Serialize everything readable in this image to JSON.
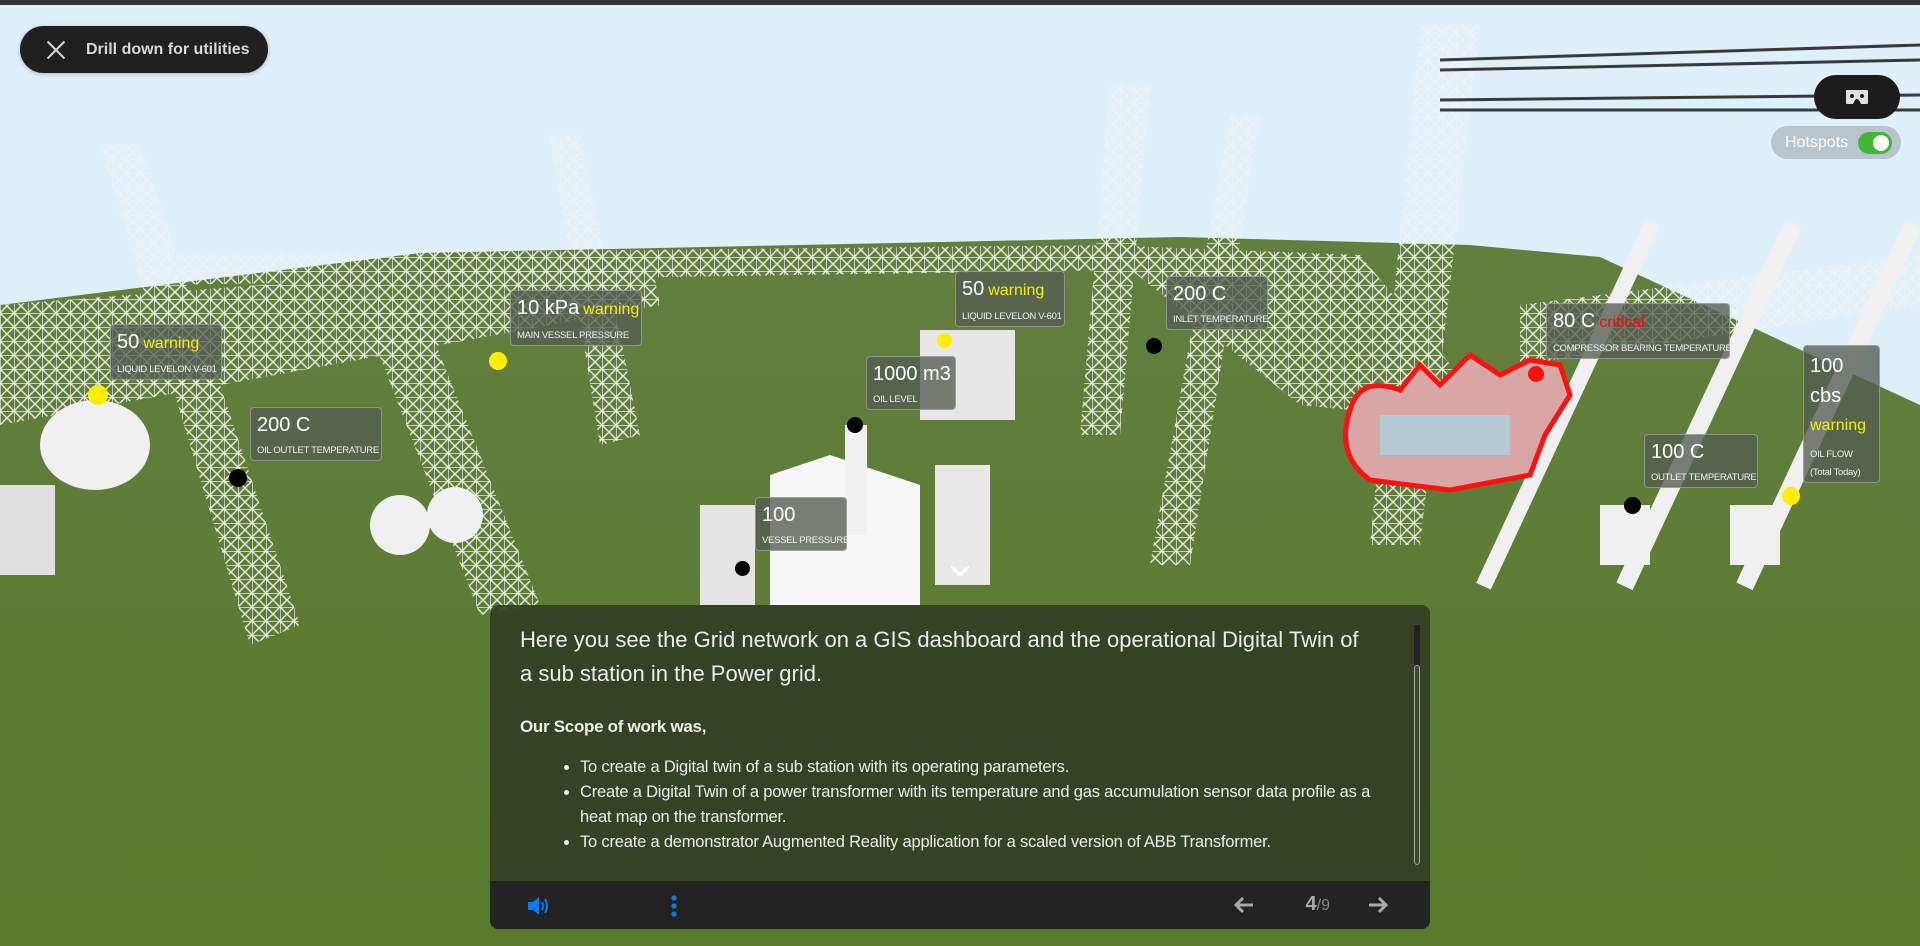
{
  "top_controls": {
    "drill_button_label": "Drill down for utilities",
    "drill_icon": "close-x-icon",
    "vr_icon": "vr-headset-icon",
    "hotspots_label": "Hotspots",
    "hotspots_enabled": true
  },
  "hotspots": [
    {
      "value": "50",
      "status": "warning",
      "name": "LIQUID LEVELON V-601",
      "dot": "yellow"
    },
    {
      "value": "10 kPa",
      "status": "warning",
      "name": "MAIN VESSEL PRESSURE",
      "dot": "yellow"
    },
    {
      "value": "200 C",
      "status": "",
      "name": "OIL OUTLET TEMPERATURE",
      "dot": "black"
    },
    {
      "value": "50",
      "status": "warning",
      "name": "LIQUID LEVELON V-601",
      "dot": "yellow"
    },
    {
      "value": "1000 m3",
      "status": "",
      "name": "OIL LEVEL",
      "dot": "black"
    },
    {
      "value": "200 C",
      "status": "",
      "name": "INLET TEMPERATURE",
      "dot": "black"
    },
    {
      "value": "100",
      "status": "",
      "name": "VESSEL PRESSURE",
      "dot": "black"
    },
    {
      "value": "80 C",
      "status": "critical",
      "name": "COMPRESSOR BEARING TEMPERATURE",
      "dot": "red"
    },
    {
      "value": "100 C",
      "status": "",
      "name": "OUTLET TEMPERATURE",
      "dot": "black"
    },
    {
      "value": "100 cbs",
      "status": "warning",
      "name": "OIL FLOW",
      "subname": "(Total Today)",
      "dot": "yellow"
    }
  ],
  "colors": {
    "warning": "#f4f000",
    "critical": "#e81010",
    "accent": "#0a7cf0",
    "toggle_on": "#45b536"
  },
  "panel": {
    "lead": "Here you see the Grid network on a GIS dashboard and the operational Digital Twin of a sub station in the Power grid.",
    "scope_heading": "Our Scope of work was,",
    "bullets": [
      "To create a Digital twin of a sub station with its operating parameters.",
      "Create a Digital Twin of a power transformer with its temperature and gas accumulation sensor data profile as a heat map on the transformer.",
      "To create a demonstrator Augmented Reality application for a scaled version of ABB Transformer."
    ],
    "footer": {
      "audio_icon": "speaker-volume-icon",
      "menu_icon": "more-vertical-icon",
      "prev_icon": "arrow-left-icon",
      "next_icon": "arrow-right-icon",
      "current_page": "4",
      "separator": "/",
      "total_pages": "9"
    }
  },
  "scene": {
    "expand_icon": "chevron-down-icon"
  }
}
